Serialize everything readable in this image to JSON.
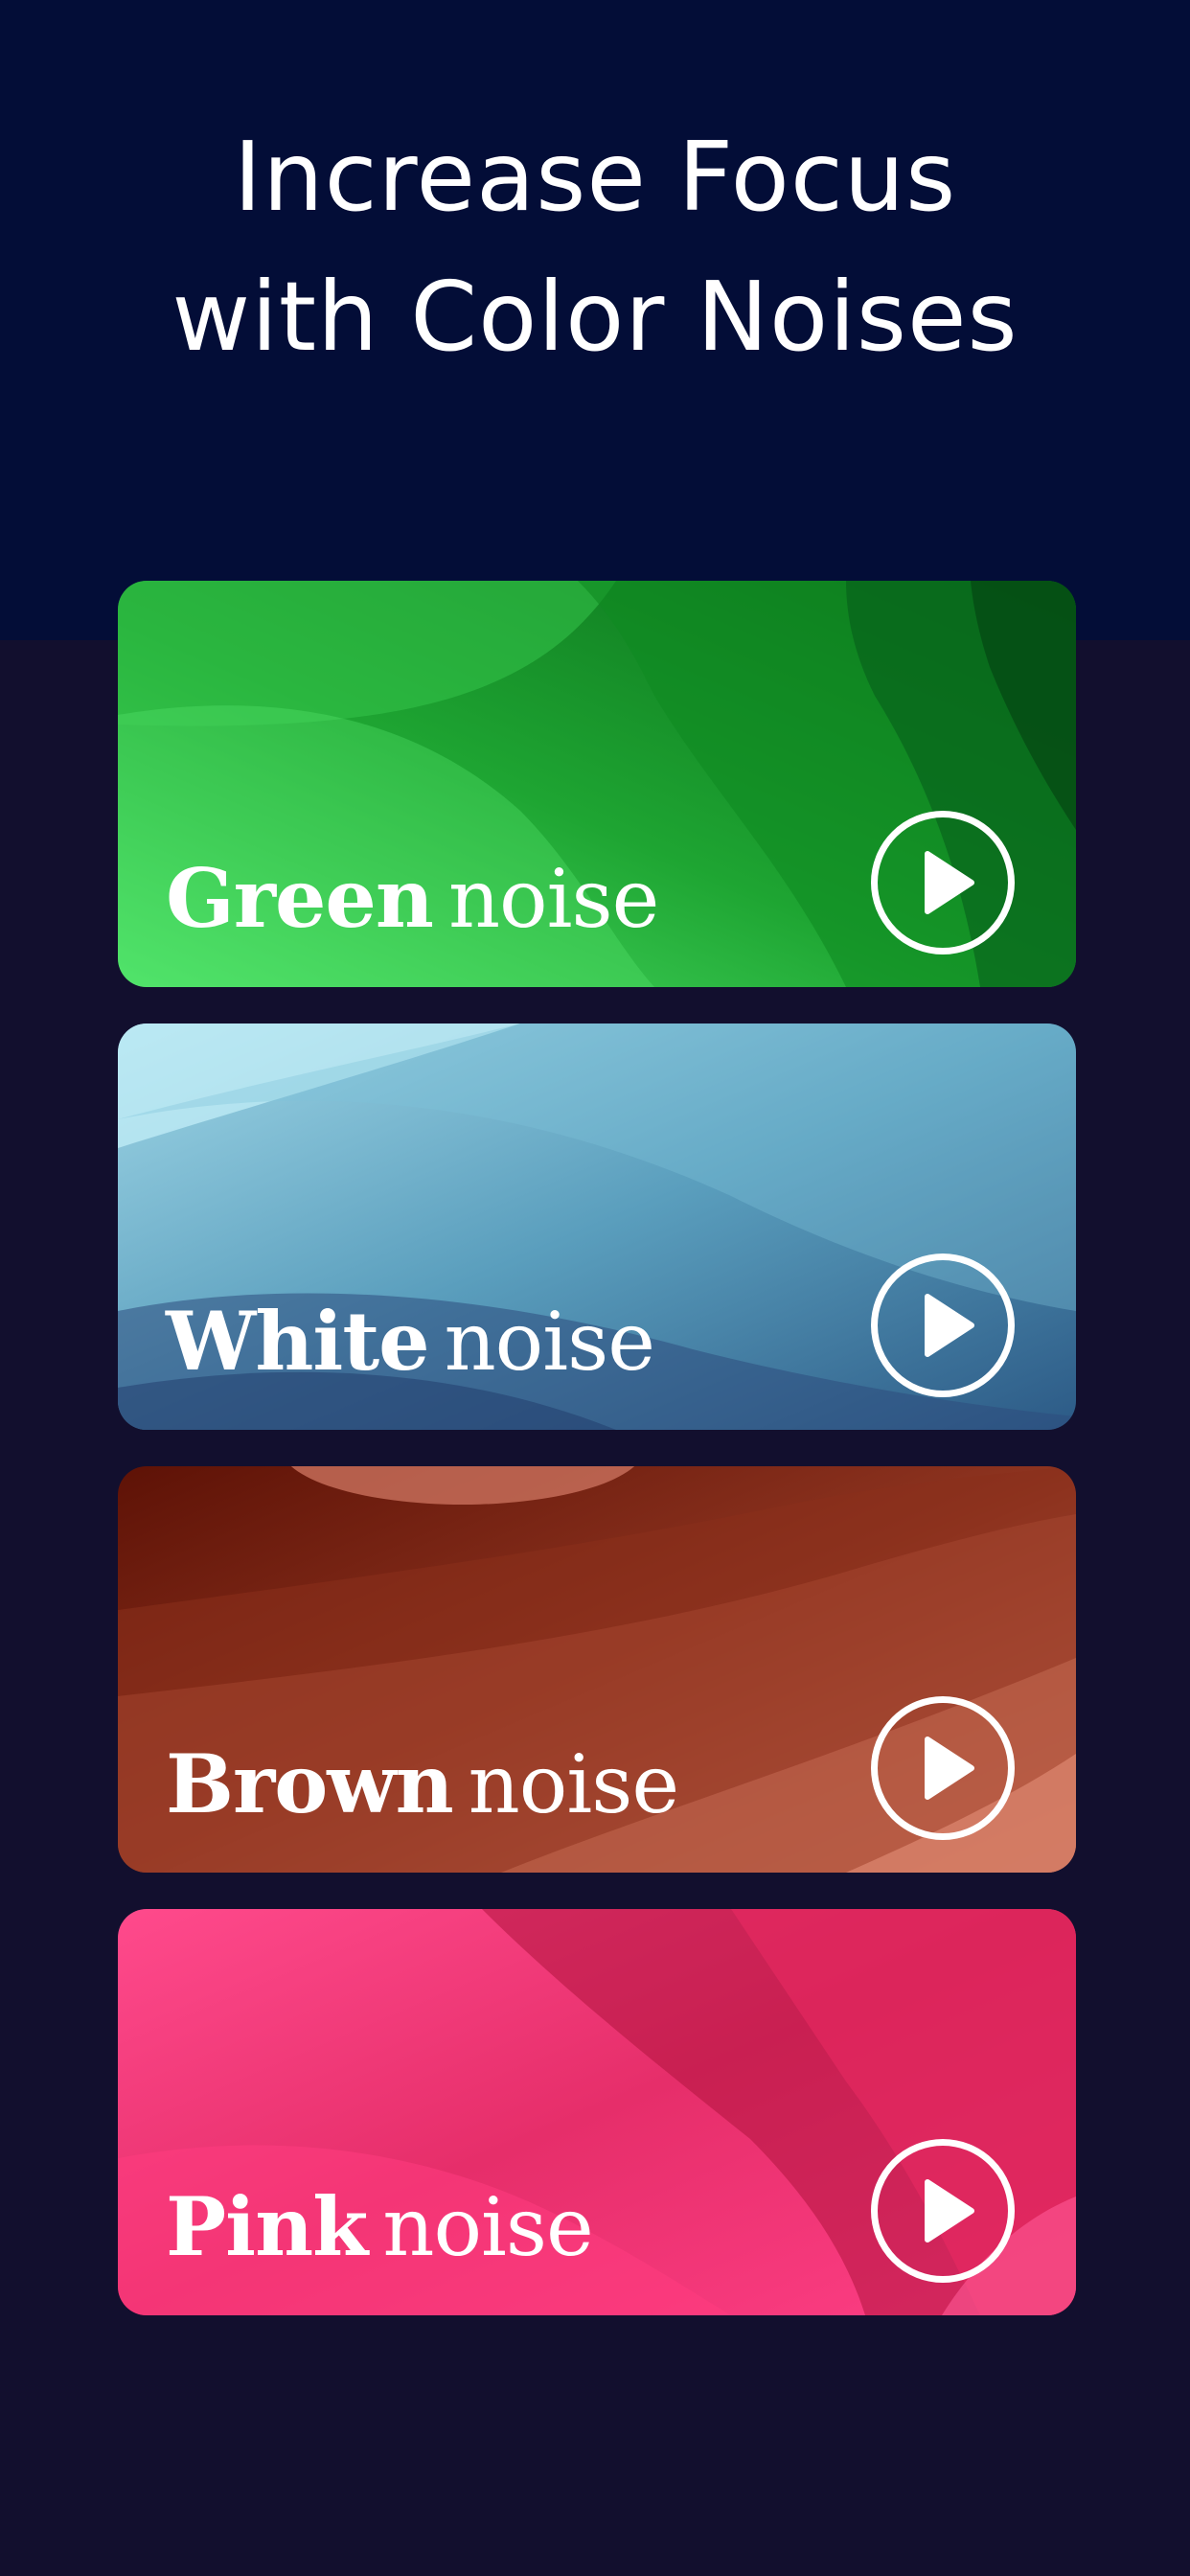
{
  "header": {
    "title_line1": "Increase Focus",
    "title_line2": "with Color Noises"
  },
  "cards": [
    {
      "strong": "Green",
      "light": "noise",
      "play_icon": "play-icon",
      "color": "#2fae3d"
    },
    {
      "strong": "White",
      "light": "noise",
      "play_icon": "play-icon",
      "color": "#5a9fbf"
    },
    {
      "strong": "Brown",
      "light": "noise",
      "play_icon": "play-icon",
      "color": "#8a2e1c"
    },
    {
      "strong": "Pink",
      "light": "noise",
      "play_icon": "play-icon",
      "color": "#f23c78"
    }
  ],
  "colors": {
    "header_background": "#030d37",
    "page_background": "#120f2e",
    "text": "#ffffff"
  }
}
